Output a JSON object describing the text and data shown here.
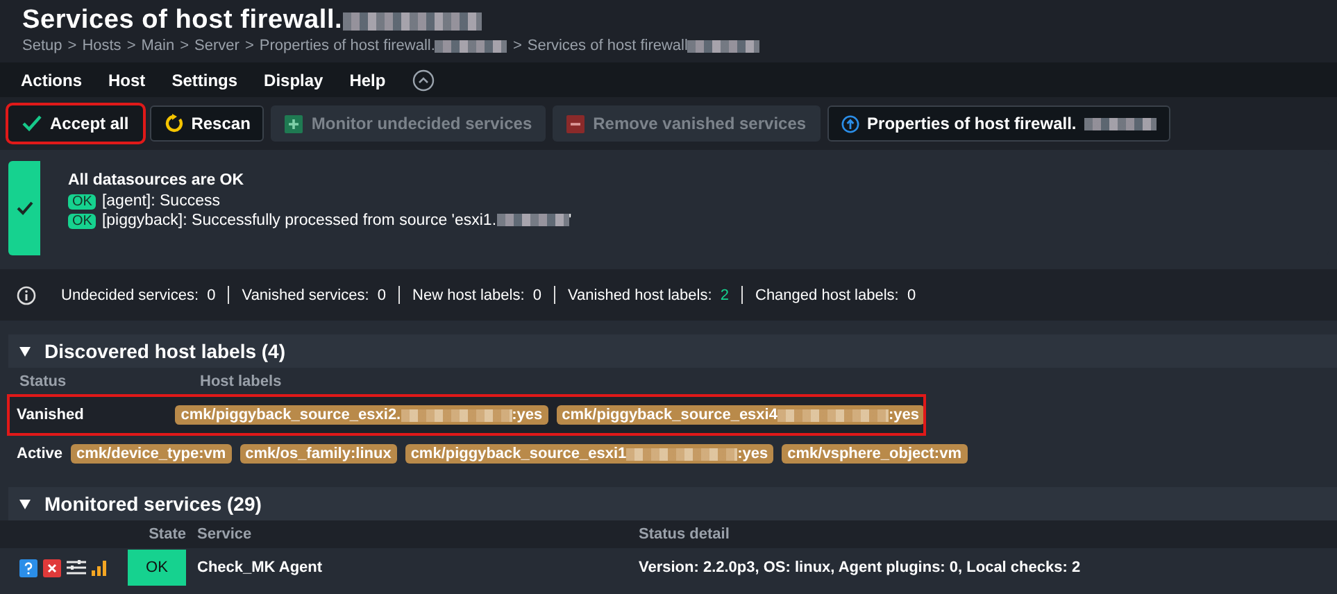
{
  "header": {
    "title": "Services of host firewall.",
    "title_redacted": true,
    "breadcrumb": [
      {
        "text": "Setup",
        "redacted": false
      },
      {
        "text": "Hosts",
        "redacted": false
      },
      {
        "text": "Main",
        "redacted": false
      },
      {
        "text": "Server",
        "redacted": false
      },
      {
        "text": "Properties of host firewall.",
        "redacted": true
      },
      {
        "text": "Services of host firewall",
        "redacted": true
      }
    ],
    "separator": ">"
  },
  "menu": {
    "items": [
      "Actions",
      "Host",
      "Settings",
      "Display",
      "Help"
    ]
  },
  "toolbar": [
    {
      "kind": "accept",
      "label": "Accept all",
      "disabled": false,
      "highlighted": true,
      "redacted": false
    },
    {
      "kind": "rescan",
      "label": "Rescan",
      "disabled": false,
      "highlighted": false,
      "redacted": false
    },
    {
      "kind": "monitor",
      "label": "Monitor undecided services",
      "disabled": true,
      "highlighted": false,
      "redacted": false
    },
    {
      "kind": "remove",
      "label": "Remove vanished services",
      "disabled": true,
      "highlighted": false,
      "redacted": false
    },
    {
      "kind": "properties",
      "label": "Properties of host firewall.",
      "disabled": false,
      "highlighted": false,
      "redacted": true
    }
  ],
  "status": {
    "title": "All datasources are OK",
    "lines": [
      {
        "badge": "OK",
        "text": "[agent]: Success",
        "redacted": false
      },
      {
        "badge": "OK",
        "text": "[piggyback]: Successfully processed from source 'esxi1.",
        "redacted": true,
        "suffix": "'"
      }
    ]
  },
  "summary": [
    {
      "label": "Undecided services:",
      "value": "0",
      "highlight": false
    },
    {
      "label": "Vanished services:",
      "value": "0",
      "highlight": false
    },
    {
      "label": "New host labels:",
      "value": "0",
      "highlight": false
    },
    {
      "label": "Vanished host labels:",
      "value": "2",
      "highlight": true
    },
    {
      "label": "Changed host labels:",
      "value": "0",
      "highlight": false
    }
  ],
  "host_labels": {
    "title": "Discovered host labels (4)",
    "expanded": true,
    "columns": [
      "Status",
      "Host labels"
    ],
    "rows": [
      {
        "status": "Vanished",
        "highlighted": true,
        "labels": [
          {
            "text": "cmk/piggyback_source_esxi2.",
            "redacted": true,
            "suffix": ":yes"
          },
          {
            "text": "cmk/piggyback_source_esxi4",
            "redacted": true,
            "suffix": ":yes"
          }
        ]
      },
      {
        "status": "Active",
        "highlighted": false,
        "labels": [
          {
            "text": "cmk/device_type:vm",
            "redacted": false
          },
          {
            "text": "cmk/os_family:linux",
            "redacted": false
          },
          {
            "text": "cmk/piggyback_source_esxi1",
            "redacted": true,
            "suffix": ":yes"
          },
          {
            "text": "cmk/vsphere_object:vm",
            "redacted": false
          }
        ]
      }
    ]
  },
  "services": {
    "title": "Monitored services (29)",
    "expanded": true,
    "columns": [
      "State",
      "Service",
      "Status detail"
    ],
    "rows": [
      {
        "state": "OK",
        "service": "Check_MK Agent",
        "detail": "Version: 2.2.0p3, OS: linux, Agent plugins: 0, Local checks: 2"
      }
    ]
  }
}
